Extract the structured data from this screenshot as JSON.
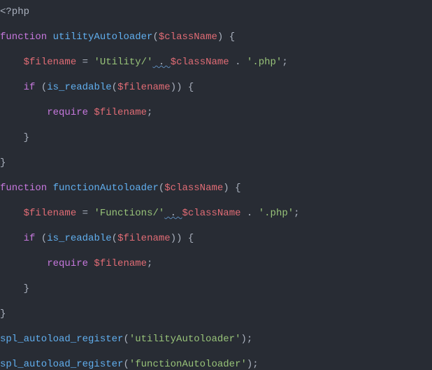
{
  "code": {
    "open_tag": "<?php",
    "fn1": {
      "keyword": "function",
      "name": "utilityAutoloader",
      "param": "$className",
      "brace_open": "{",
      "assign_var": "$filename",
      "eq": " = ",
      "str_prefix": "'Utility/'",
      "squig": " . ",
      "concat_var": "$className",
      "concat_dot": " . ",
      "str_suffix": "'.php'",
      "semicolon": ";",
      "if_kw": "if",
      "if_open": " (",
      "is_readable": "is_readable",
      "ir_open": "(",
      "ir_var": "$filename",
      "ir_close": ")) {",
      "require_kw": "require",
      "require_var": " $filename",
      "require_semi": ";",
      "close_brace_inner": "}",
      "close_brace_outer": "}"
    },
    "fn2": {
      "keyword": "function",
      "name": "functionAutoloader",
      "param": "$className",
      "brace_open": "{",
      "assign_var": "$filename",
      "eq": " = ",
      "str_prefix": "'Functions/'",
      "squig": " . ",
      "concat_var": "$className",
      "concat_dot": " . ",
      "str_suffix": "'.php'",
      "semicolon": ";",
      "if_kw": "if",
      "if_open": " (",
      "is_readable": "is_readable",
      "ir_open": "(",
      "ir_var": "$filename",
      "ir_close": ")) {",
      "require_kw": "require",
      "require_var": " $filename",
      "require_semi": ";",
      "close_brace_inner": "}",
      "close_brace_outer": "}"
    },
    "reg1": {
      "fn": "spl_autoload_register",
      "open": "(",
      "arg": "'utilityAutoloader'",
      "close": ");"
    },
    "reg2": {
      "fn": "spl_autoload_register",
      "open": "(",
      "arg": "'functionAutoloader'",
      "close": ");"
    }
  }
}
